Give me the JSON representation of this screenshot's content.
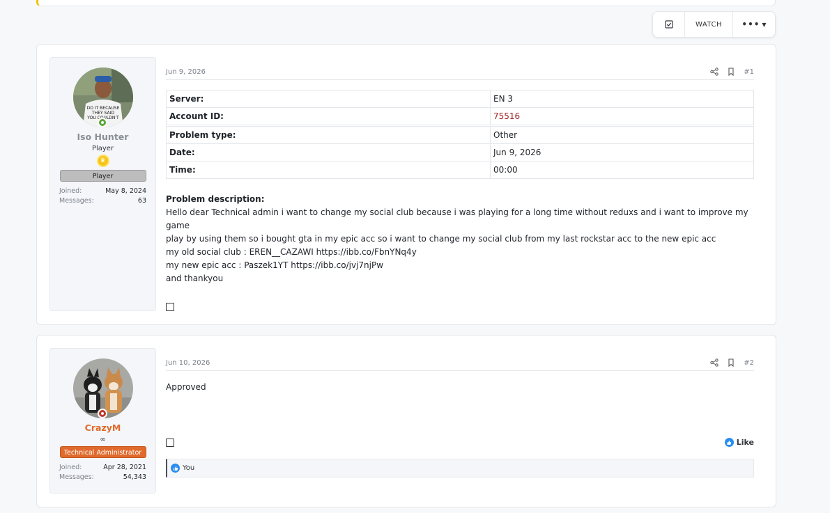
{
  "thread_actions": {
    "watch_label": "WATCH",
    "more_label": "•••"
  },
  "posts": [
    {
      "user": {
        "name": "Iso Hunter",
        "name_color": "#8a8f96",
        "title": "Player",
        "banner": "Player",
        "status_color": "#5aa83a",
        "joined_label": "Joined:",
        "joined_value": "May 8, 2024",
        "messages_label": "Messages:",
        "messages_value": "63"
      },
      "date": "Jun 9, 2026",
      "number": "#1",
      "table": [
        {
          "key": "Server:",
          "value": "EN 3"
        },
        {
          "key": "Account ID:",
          "value": "75516"
        },
        {
          "key": "Problem type:",
          "value": "Other"
        },
        {
          "key": "Date:",
          "value": "Jun 9, 2026"
        },
        {
          "key": "Time:",
          "value": "00:00"
        }
      ],
      "description_title": "Problem description:",
      "description_lines": [
        "Hello dear Technical admin i want to change my social club because i was playing for a long time without reduxs and i want to improve my game",
        "play by using them so i bought gta in my epic acc so i want to change my social club from my last rockstar acc to the new epic acc",
        "my old social club : EREN__CAZAWI https://ibb.co/FbnYNq4y",
        "my new epic acc : Paszek1YT https://ibb.co/jvj7njPw",
        "and thankyou"
      ]
    },
    {
      "user": {
        "name": "CrazyM",
        "name_color": "#e06a2c",
        "title": "∞",
        "banner": "Technical Administrator",
        "status_color": "#c0392b",
        "joined_label": "Joined:",
        "joined_value": "Apr 28, 2021",
        "messages_label": "Messages:",
        "messages_value": "54,343"
      },
      "date": "Jun 10, 2026",
      "number": "#2",
      "message": "Approved",
      "like_label": "Like",
      "reactions_text": "You"
    }
  ]
}
